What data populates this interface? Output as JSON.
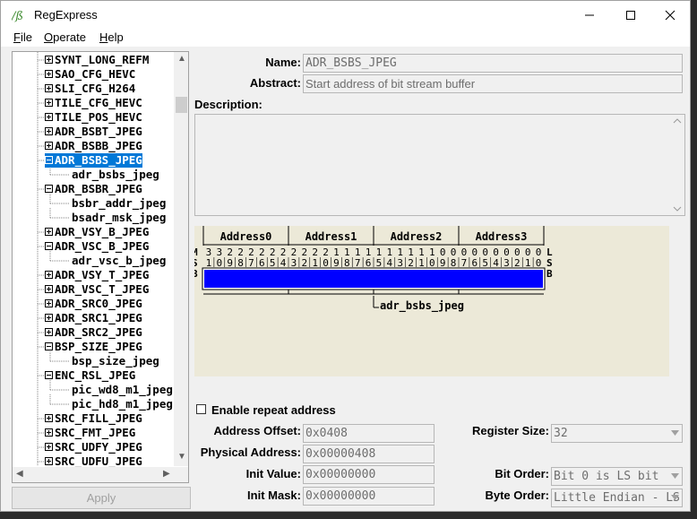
{
  "app": {
    "title": "RegExpress"
  },
  "menu": {
    "file": "File",
    "file_key": "F",
    "file_rest": "ile",
    "operate": "Operate",
    "operate_key": "O",
    "operate_rest": "perate",
    "help": "Help",
    "help_key": "H",
    "help_rest": "elp"
  },
  "tree": {
    "nodes": [
      {
        "label": "SYNT_LONG_REFM",
        "state": "collapsed",
        "level": 0
      },
      {
        "label": "SAO_CFG_HEVC",
        "state": "collapsed",
        "level": 0
      },
      {
        "label": "SLI_CFG_H264",
        "state": "collapsed",
        "level": 0
      },
      {
        "label": "TILE_CFG_HEVC",
        "state": "collapsed",
        "level": 0
      },
      {
        "label": "TILE_POS_HEVC",
        "state": "collapsed",
        "level": 0
      },
      {
        "label": "ADR_BSBT_JPEG",
        "state": "collapsed",
        "level": 0
      },
      {
        "label": "ADR_BSBB_JPEG",
        "state": "collapsed",
        "level": 0
      },
      {
        "label": "ADR_BSBS_JPEG",
        "state": "expanded",
        "level": 0,
        "selected": true
      },
      {
        "label": "adr_bsbs_jpeg",
        "state": "leaf",
        "level": 1
      },
      {
        "label": "ADR_BSBR_JPEG",
        "state": "expanded",
        "level": 0
      },
      {
        "label": "bsbr_addr_jpeg",
        "state": "leaf",
        "level": 1
      },
      {
        "label": "bsadr_msk_jpeg",
        "state": "leaf",
        "level": 1
      },
      {
        "label": "ADR_VSY_B_JPEG",
        "state": "collapsed",
        "level": 0
      },
      {
        "label": "ADR_VSC_B_JPEG",
        "state": "expanded",
        "level": 0
      },
      {
        "label": "adr_vsc_b_jpeg",
        "state": "leaf",
        "level": 1
      },
      {
        "label": "ADR_VSY_T_JPEG",
        "state": "collapsed",
        "level": 0
      },
      {
        "label": "ADR_VSC_T_JPEG",
        "state": "collapsed",
        "level": 0
      },
      {
        "label": "ADR_SRC0_JPEG",
        "state": "collapsed",
        "level": 0
      },
      {
        "label": "ADR_SRC1_JPEG",
        "state": "collapsed",
        "level": 0
      },
      {
        "label": "ADR_SRC2_JPEG",
        "state": "collapsed",
        "level": 0
      },
      {
        "label": "BSP_SIZE_JPEG",
        "state": "expanded",
        "level": 0
      },
      {
        "label": "bsp_size_jpeg",
        "state": "leaf",
        "level": 1
      },
      {
        "label": "ENC_RSL_JPEG",
        "state": "expanded",
        "level": 0
      },
      {
        "label": "pic_wd8_m1_jpeg",
        "state": "leaf",
        "level": 1
      },
      {
        "label": "pic_hd8_m1_jpeg",
        "state": "leaf",
        "level": 1
      },
      {
        "label": "SRC_FILL_JPEG",
        "state": "collapsed",
        "level": 0
      },
      {
        "label": "SRC_FMT_JPEG",
        "state": "collapsed",
        "level": 0
      },
      {
        "label": "SRC_UDFY_JPEG",
        "state": "collapsed",
        "level": 0
      },
      {
        "label": "SRC_UDFU_JPEG",
        "state": "collapsed",
        "level": 0
      }
    ]
  },
  "apply_label": "Apply",
  "details": {
    "name_label": "Name:",
    "name_value": "ADR_BSBS_JPEG",
    "abstract_label": "Abstract:",
    "abstract_value": "Start address of bit stream buffer",
    "description_label": "Description:",
    "description_value": ""
  },
  "bitmap": {
    "address_headers": [
      "Address0",
      "Address1",
      "Address2",
      "Address3"
    ],
    "msb_label": [
      "M",
      "S",
      "B"
    ],
    "lsb_label": [
      "L",
      "S",
      "B"
    ],
    "bit_tens": [
      "3",
      "3",
      "2",
      "2",
      "2",
      "2",
      "2",
      "2",
      "2",
      "2",
      "2",
      "2",
      "1",
      "1",
      "1",
      "1",
      "1",
      "1",
      "1",
      "1",
      "1",
      "1",
      "0",
      "0",
      "0",
      "0",
      "0",
      "0",
      "0",
      "0",
      "0",
      "0"
    ],
    "bit_ones": [
      "1",
      "0",
      "9",
      "8",
      "7",
      "6",
      "5",
      "4",
      "3",
      "2",
      "1",
      "0",
      "9",
      "8",
      "7",
      "6",
      "5",
      "4",
      "3",
      "2",
      "1",
      "0",
      "9",
      "8",
      "7",
      "6",
      "5",
      "4",
      "3",
      "2",
      "1",
      "0"
    ],
    "field_name": "adr_bsbs_jpeg",
    "field_msb": 31,
    "field_lsb": 0,
    "field_color": "#0000ff"
  },
  "options": {
    "repeat_label": "Enable repeat address",
    "repeat_checked": false,
    "offset_label": "Address Offset:",
    "offset_value": "0x0408",
    "physical_label": "Physical Address:",
    "physical_value": "0x00000408",
    "init_value_label": "Init Value:",
    "init_value": "0x00000000",
    "init_mask_label": "Init Mask:",
    "init_mask": "0x00000000",
    "reg_size_label": "Register Size:",
    "reg_size_value": "32",
    "bit_order_label": "Bit Order:",
    "bit_order_value": "Bit 0 is LS bit",
    "byte_order_label": "Byte Order:",
    "byte_order_value": "Little Endian - LS by"
  }
}
